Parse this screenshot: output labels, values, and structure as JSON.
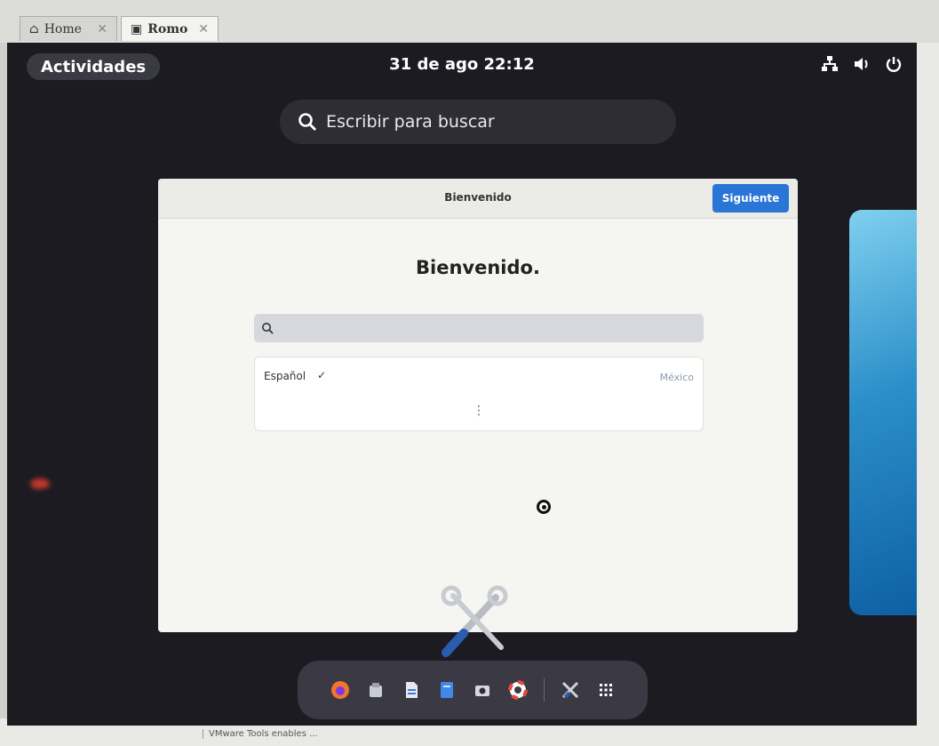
{
  "vmware": {
    "tabs": [
      {
        "label": "Home",
        "icon": "home-icon"
      },
      {
        "label": "Romo",
        "icon": "vm-icon"
      }
    ],
    "close_glyph": "✕",
    "status_text": "VMware Tools enables ..."
  },
  "topbar": {
    "activities_label": "Actividades",
    "clock": "31 de ago  22:12",
    "icons": [
      "network-icon",
      "volume-icon",
      "power-icon"
    ]
  },
  "overview": {
    "search_placeholder": "Escribir para buscar"
  },
  "window": {
    "title": "Bienvenido",
    "next_button": "Siguiente",
    "heading": "Bienvenido.",
    "language": {
      "selected_name": "Español",
      "check_glyph": "✓",
      "region": "México",
      "more_glyph": "⋮"
    }
  },
  "dash": {
    "apps": [
      "firefox-icon",
      "files-icon",
      "text-editor-icon",
      "document-icon",
      "camera-icon",
      "help-icon",
      "tools-icon",
      "app-grid-icon"
    ]
  },
  "colors": {
    "accent": "#2a76d6",
    "screen_bg": "#1c1b22",
    "dash_bg": "#3b3a44"
  }
}
